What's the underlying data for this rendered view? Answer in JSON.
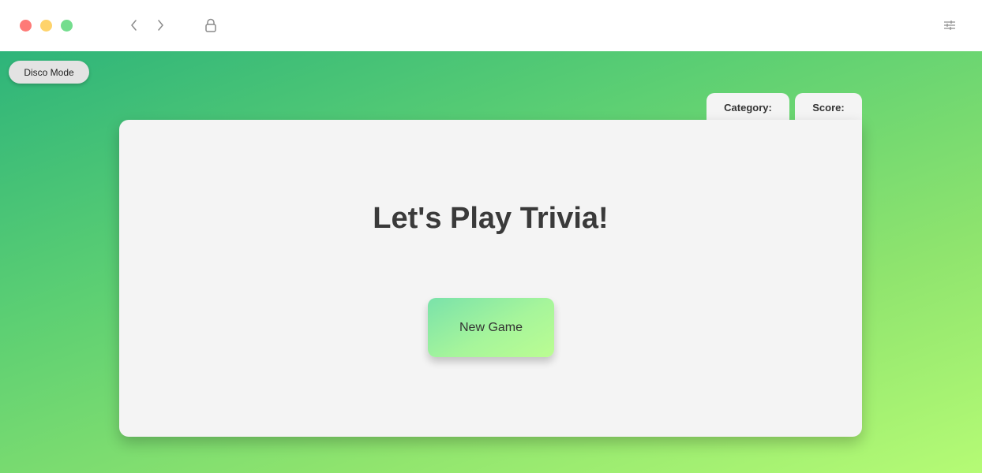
{
  "browser": {
    "colors": {
      "close": "#fe7a77",
      "minimize": "#fed36b",
      "maximize": "#74dd8e",
      "icon": "#8a8a8a"
    }
  },
  "page": {
    "disco_button_label": "Disco Mode",
    "tabs": [
      {
        "label": "Category:"
      },
      {
        "label": "Score:"
      }
    ],
    "title": "Let's Play Trivia!",
    "new_game_label": "New Game",
    "colors": {
      "background_start": "#2eb47a",
      "background_end": "#b5fb75",
      "card": "#f4f4f4",
      "button_start": "#7ae2aa",
      "button_end": "#bbfd92"
    }
  }
}
